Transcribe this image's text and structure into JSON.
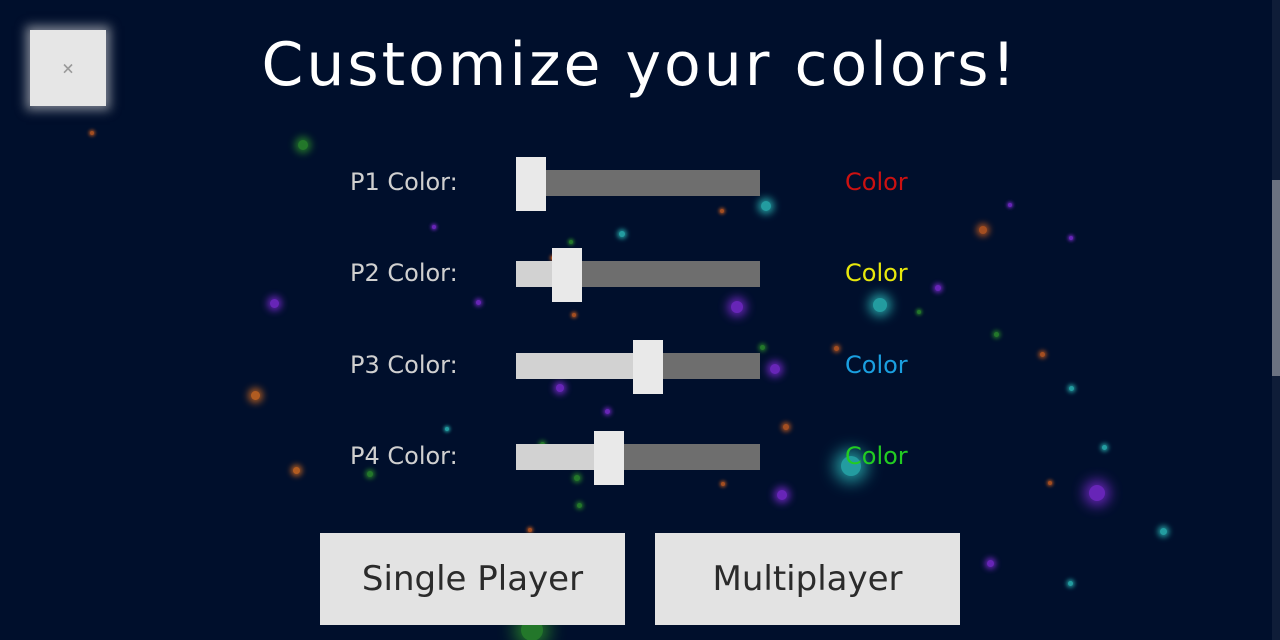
{
  "close": {
    "glyph": "×"
  },
  "title": "Customize your colors!",
  "rows": [
    {
      "label": "P1 Color:",
      "value": 0.06,
      "swatch_text": "Color",
      "swatch_color": "#cc1111"
    },
    {
      "label": "P2 Color:",
      "value": 0.21,
      "swatch_text": "Color",
      "swatch_color": "#e8e80c"
    },
    {
      "label": "P3 Color:",
      "value": 0.54,
      "swatch_text": "Color",
      "swatch_color": "#1a9fe0"
    },
    {
      "label": "P4 Color:",
      "value": 0.38,
      "swatch_text": "Color",
      "swatch_color": "#22cc22"
    }
  ],
  "buttons": {
    "single": "Single Player",
    "multi": "Multiplayer"
  },
  "colors": {
    "background": "#000f2c",
    "slider_track": "#6e6e6e",
    "slider_fill": "#d2d2d2",
    "button_bg": "#e3e3e3"
  }
}
